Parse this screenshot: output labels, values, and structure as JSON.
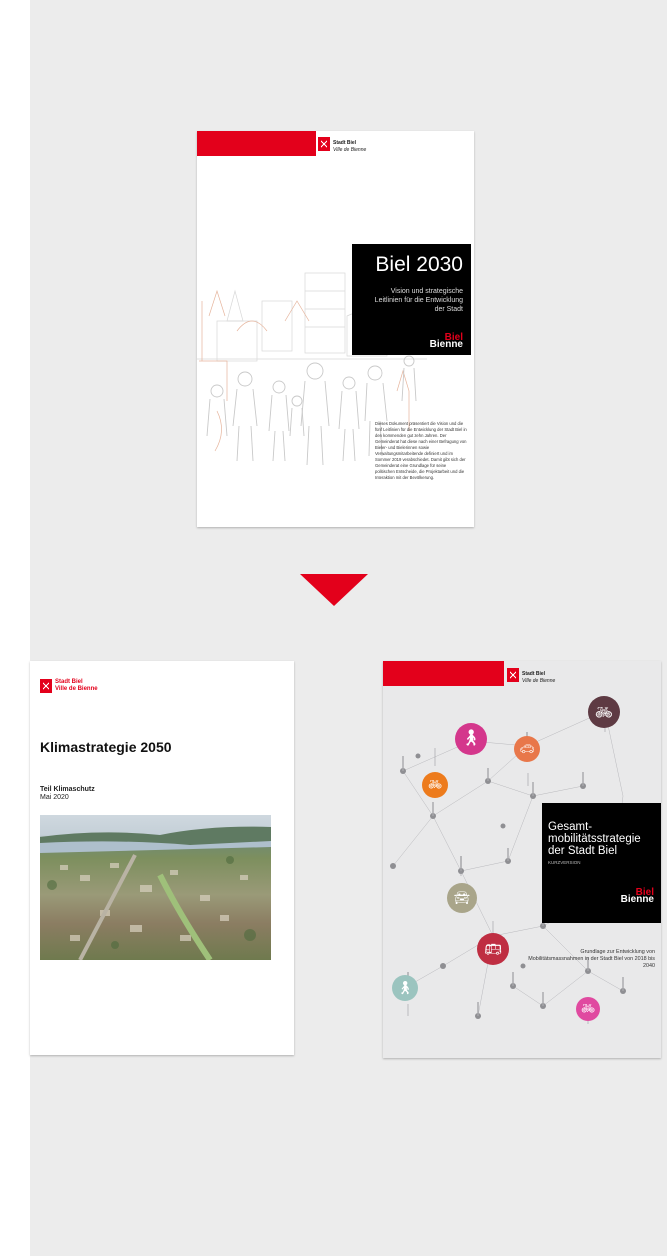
{
  "brand": {
    "name": "Stadt Biel",
    "name_fr": "Ville de Bienne",
    "logo_main": "Biel",
    "logo_sub": "Bienne",
    "accent_color": "#e3001b"
  },
  "documents": [
    {
      "title": "Biel 2030",
      "subtitle": "Vision und strategische Leitlinien für die Entwicklung der Stadt",
      "body_text": "Dieses Dokument präsentiert die Vision und die fünf Leitlinien für die Entwicklung der Stadt Biel in den kommenden gut zehn Jahren. Der Gemeinderat hat diese nach einer Befragung von Bieler- und Bielerinnen sowie Verwaltungsmitarbeitende definiert und im Sommer 2019 verabschiedet. Damit gibt sich der Gemeinderat eine Grundlage für seine politischen Entscheide, die Projektarbeit und die Interaktion mit der Bevölkerung."
    },
    {
      "title": "Klimastrategie 2050",
      "subtitle": "Teil Klimaschutz",
      "date": "Mai 2020"
    },
    {
      "title": "Gesamt-mobilitätsstrategie der Stadt Biel",
      "subtitle": "KURZVERSION",
      "footer": "Grundlage zur Entwicklung von Mobilitätsmassnahmen in der Stadt Biel von 2018 bis 2040"
    }
  ]
}
